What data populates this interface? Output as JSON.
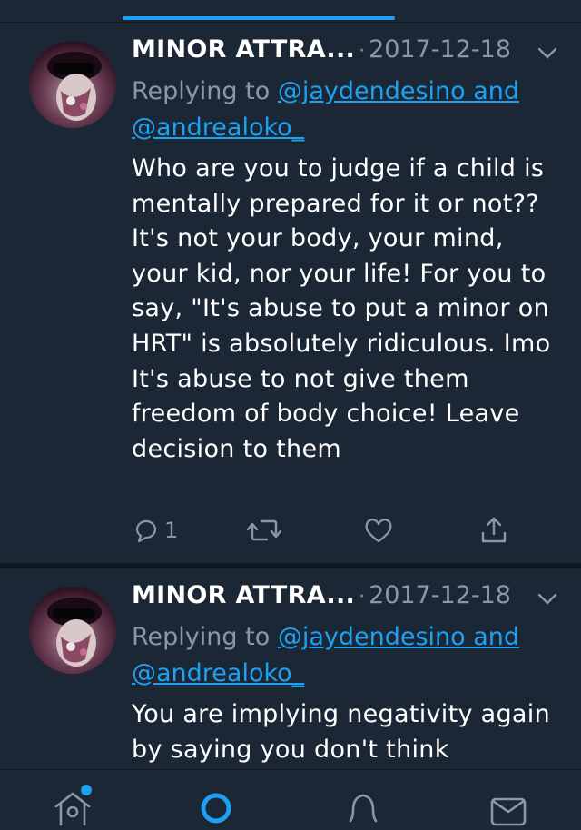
{
  "colors": {
    "background": "#1b2735",
    "accent": "#1da1f2",
    "muted": "#8899a6"
  },
  "tweets": [
    {
      "name": "MINOR ATTRA...",
      "date": "2017-12-18",
      "replying_prefix": "Replying to ",
      "mention1": "@jaydendesino and",
      "mention2": "@andrealoko_",
      "text": "Who are you to judge if a child is mentally prepared for it or not?? It's not your body, your mind, your kid, nor your life! For you to say, \"It's abuse to put a minor on HRT\" is absolutely ridiculous. Imo It's abuse to not give them freedom of body choice! Leave decision to them",
      "reply_count": "1"
    },
    {
      "name": "MINOR ATTRA...",
      "date": "2017-12-18",
      "replying_prefix": "Replying to ",
      "mention1": "@jaydendesino and",
      "mention2": "@andrealoko_",
      "text": "You are implying negativity again by saying you don't think"
    }
  ],
  "icons": [
    "reply-icon",
    "retweet-icon",
    "like-icon",
    "share-icon",
    "home-icon",
    "search-icon",
    "notifications-icon",
    "messages-icon",
    "chevron-down-icon"
  ]
}
